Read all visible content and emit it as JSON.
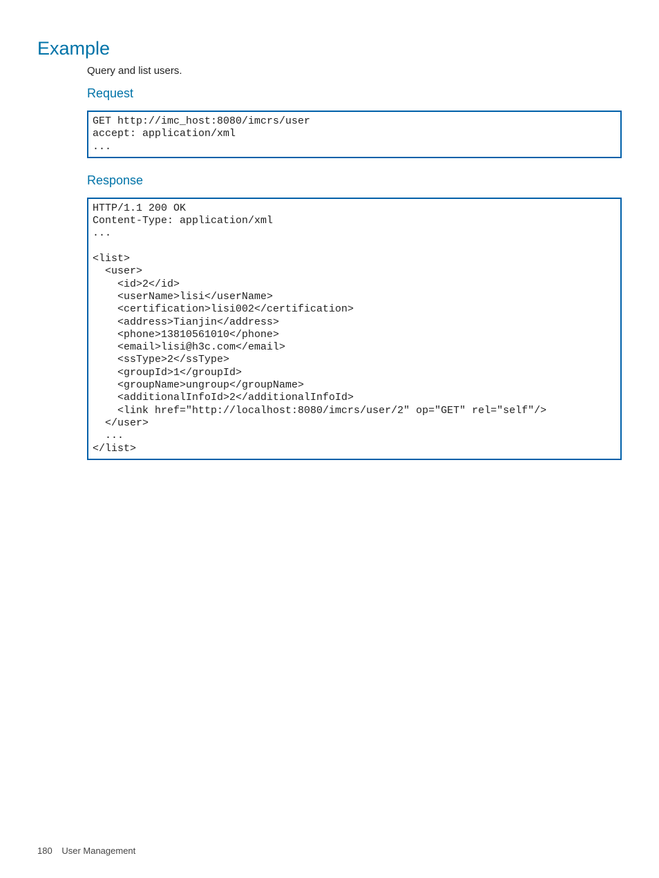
{
  "headings": {
    "example": "Example",
    "request": "Request",
    "response": "Response"
  },
  "intro": "Query and list users.",
  "request_code": "GET http://imc_host:8080/imcrs/user\naccept: application/xml\n...",
  "response_code": "HTTP/1.1 200 OK\nContent-Type: application/xml\n...\n\n<list>\n  <user>\n    <id>2</id>\n    <userName>lisi</userName>\n    <certification>lisi002</certification>\n    <address>Tianjin</address>\n    <phone>13810561010</phone>\n    <email>lisi@h3c.com</email>\n    <ssType>2</ssType>\n    <groupId>1</groupId>\n    <groupName>ungroup</groupName>\n    <additionalInfoId>2</additionalInfoId>\n    <link href=\"http://localhost:8080/imcrs/user/2\" op=\"GET\" rel=\"self\"/>\n  </user>\n  ...\n</list>",
  "footer": {
    "page_number": "180",
    "section": "User Management"
  }
}
